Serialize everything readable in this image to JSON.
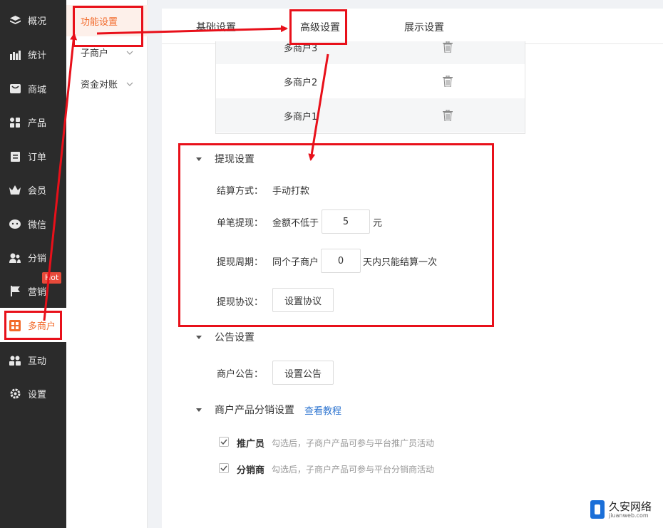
{
  "nav": {
    "items": [
      {
        "label": "概况",
        "icon": "layers-icon"
      },
      {
        "label": "统计",
        "icon": "chart-icon"
      },
      {
        "label": "商城",
        "icon": "store-icon"
      },
      {
        "label": "产品",
        "icon": "grid-icon"
      },
      {
        "label": "订单",
        "icon": "clipboard-icon"
      },
      {
        "label": "会员",
        "icon": "crown-icon"
      },
      {
        "label": "微信",
        "icon": "wechat-icon"
      },
      {
        "label": "分销",
        "icon": "users-icon"
      },
      {
        "label": "营销",
        "icon": "flag-icon"
      },
      {
        "label": "多商户",
        "icon": "shop-icon"
      },
      {
        "label": "互动",
        "icon": "people-icon"
      },
      {
        "label": "设置",
        "icon": "gear-icon"
      }
    ],
    "hot_badge": "Hot"
  },
  "submenu": {
    "items": [
      {
        "label": "功能设置"
      },
      {
        "label": "子商户"
      },
      {
        "label": "资金对账"
      }
    ]
  },
  "tabs": [
    {
      "label": "基础设置"
    },
    {
      "label": "高级设置"
    },
    {
      "label": "展示设置"
    }
  ],
  "merchant_table": {
    "rows": [
      {
        "name": "多商户3"
      },
      {
        "name": "多商户2"
      },
      {
        "name": "多商户1"
      }
    ]
  },
  "withdraw": {
    "title": "提现设置",
    "settle_label": "结算方式：",
    "settle_value": "手动打款",
    "single_label": "单笔提现：",
    "single_prefix": "金额不低于",
    "single_value": "5",
    "single_unit": "元",
    "period_label": "提现周期：",
    "period_prefix": "同个子商户",
    "period_value": "0",
    "period_suffix": "天内只能结算一次",
    "agreement_label": "提现协议：",
    "agreement_button": "设置协议"
  },
  "notice": {
    "title": "公告设置",
    "label": "商户公告：",
    "button": "设置公告"
  },
  "distribution": {
    "title": "商户产品分销设置",
    "tutorial_link": "查看教程",
    "options": [
      {
        "label": "推广员",
        "hint": "勾选后，子商户产品可参与平台推广员活动",
        "checked": true
      },
      {
        "label": "分销商",
        "hint": "勾选后，子商户产品可参与平台分销商活动",
        "checked": true
      }
    ]
  },
  "watermark": {
    "name": "久安网络",
    "domain": "jiuanweb.com"
  },
  "colors": {
    "accent": "#f26a2a",
    "annotation_red": "#e8101a",
    "link": "#2d74d0",
    "nav_bg": "#2b2b2b"
  }
}
